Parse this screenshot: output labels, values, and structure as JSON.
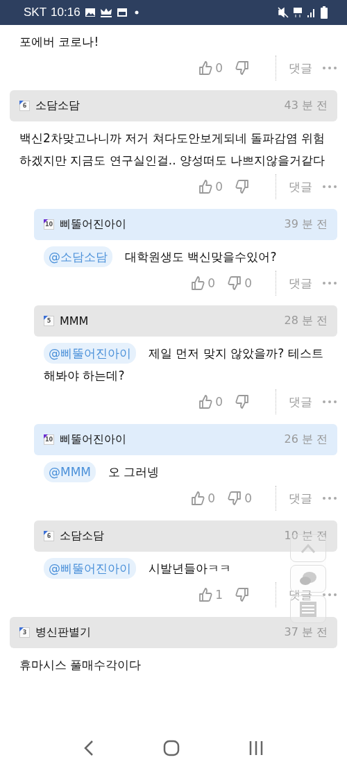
{
  "status_bar": {
    "carrier": "SKT",
    "time": "10:16"
  },
  "comments": [
    {
      "kind": "comment",
      "body": "포에버 코로나!",
      "likes": "0",
      "reply_label": "댓글"
    },
    {
      "kind": "comment",
      "author": "소담소담",
      "badge": {
        "text": "6",
        "color": "#3b6fd6"
      },
      "time": "43 분 전",
      "highlighted": false,
      "body": "백신2차맞고나니까 저거 쳐다도안보게되네 돌파감염 위험하겠지만 지금도 연구실인걸.. 양성떠도 나쁘지않을거같다",
      "likes": "0",
      "reply_label": "댓글"
    },
    {
      "kind": "reply",
      "author": "삐뚤어진아이",
      "badge": {
        "text": "10",
        "color": "#6a2bd0"
      },
      "time": "39 분 전",
      "highlighted": true,
      "mention": "@소담소담",
      "body": "대학원생도 백신맞을수있어?",
      "likes": "0",
      "dislikes": "0",
      "reply_label": "댓글"
    },
    {
      "kind": "reply",
      "author": "MMM",
      "badge": {
        "text": "5",
        "color": "#3b6fd6"
      },
      "time": "28 분 전",
      "highlighted": false,
      "mention": "@삐뚤어진아이",
      "body": "제일 먼저 맞지 않았을까? 테스트 해봐야 하는데?",
      "likes": "0",
      "reply_label": "댓글"
    },
    {
      "kind": "reply",
      "author": "삐뚤어진아이",
      "badge": {
        "text": "10",
        "color": "#6a2bd0"
      },
      "time": "26 분 전",
      "highlighted": true,
      "mention": "@MMM",
      "body": "오 그러넹",
      "likes": "0",
      "dislikes": "0",
      "reply_label": "댓글"
    },
    {
      "kind": "reply",
      "author": "소담소담",
      "badge": {
        "text": "6",
        "color": "#3b6fd6"
      },
      "time": "10 분 전",
      "highlighted": false,
      "mention": "@삐뚤어진아이",
      "body": "시발년들아ㅋㅋ",
      "likes": "1",
      "reply_label": "댓글"
    },
    {
      "kind": "comment",
      "author": "병신판별기",
      "badge": {
        "text": "3",
        "color": "#3b6fd6"
      },
      "time": "37 분 전",
      "highlighted": false,
      "body": "휴마시스 풀매수각이다"
    }
  ]
}
